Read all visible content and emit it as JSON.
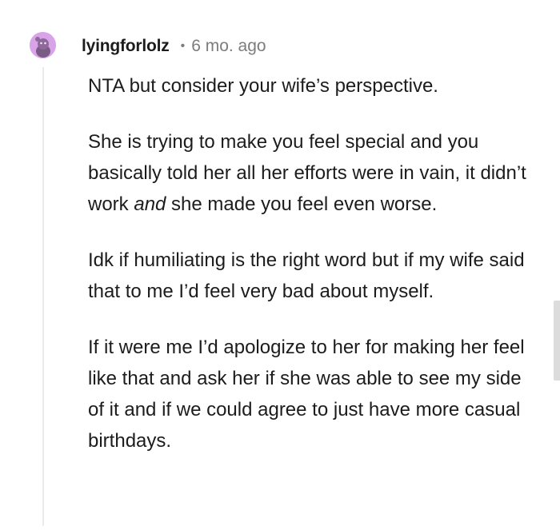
{
  "comment": {
    "username": "lyingforlolz",
    "separator": "•",
    "timestamp": "6 mo. ago",
    "avatar_icon": "snoo-avatar-icon",
    "avatar_color": "#d9a3ea",
    "paragraphs": [
      "NTA but consider your wife’s perspective.",
      {
        "before": "She is trying to make you feel special and you basically told her all her efforts were in vain, it didn’t work ",
        "emphasis": "and",
        "after": " she made you feel even worse."
      },
      "Idk if humiliating is the right word but if my wife said that to me I’d feel very bad about myself.",
      "If it were me I’d apologize to her for making her feel like that and ask her if she was able to see my side of it and if we could agree to just have more casual birthdays."
    ]
  }
}
